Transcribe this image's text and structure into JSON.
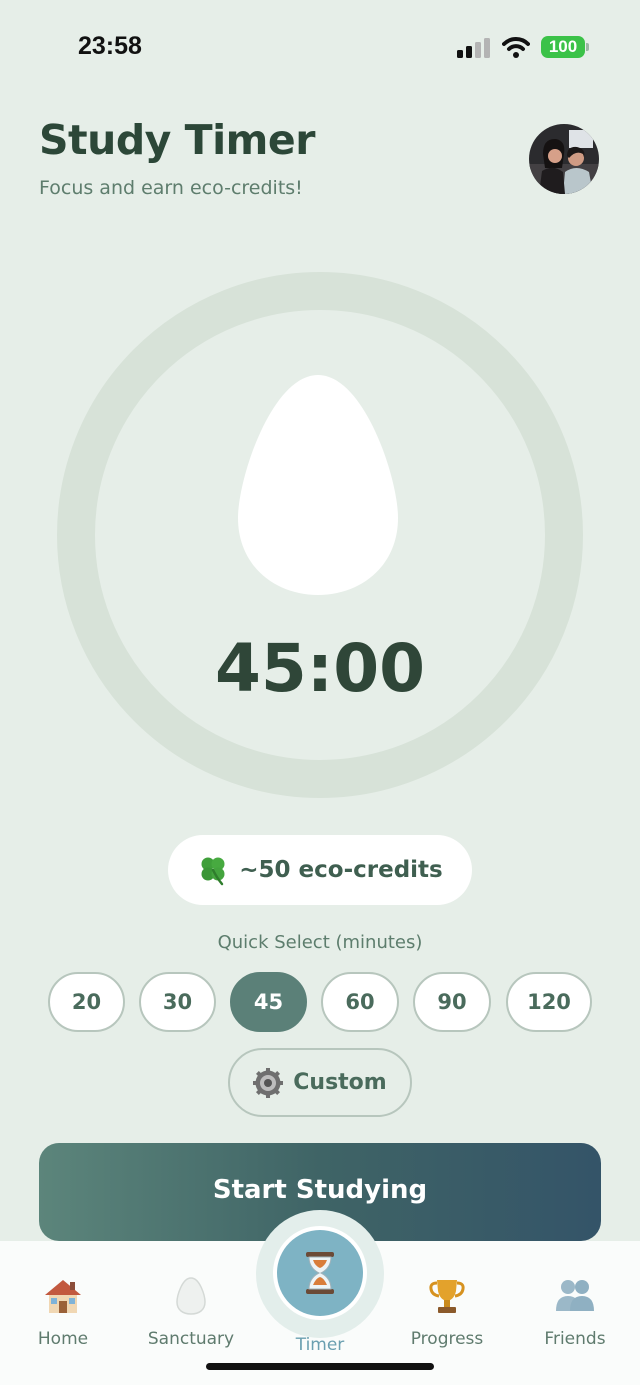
{
  "status_bar": {
    "time": "23:58",
    "battery": "100"
  },
  "header": {
    "title": "Study Timer",
    "subtitle": "Focus and earn eco-credits!"
  },
  "timer": {
    "display": "45:00"
  },
  "credits": {
    "text": "~50 eco-credits"
  },
  "quick_select": {
    "label": "Quick Select (minutes)",
    "options": [
      "20",
      "30",
      "45",
      "60",
      "90",
      "120"
    ],
    "selected": "45"
  },
  "custom_label": "Custom",
  "start_label": "Start Studying",
  "tabs": [
    {
      "label": "Home",
      "icon": "house-icon"
    },
    {
      "label": "Sanctuary",
      "icon": "egg-icon"
    },
    {
      "label": "Timer",
      "icon": "hourglass-icon",
      "active": true
    },
    {
      "label": "Progress",
      "icon": "trophy-icon"
    },
    {
      "label": "Friends",
      "icon": "people-icon"
    }
  ],
  "colors": {
    "background": "#e6eee8",
    "accent": "#5b8078",
    "title": "#2c4738",
    "battery": "#3bc248",
    "start_gradient_start": "#5c857b",
    "start_gradient_end": "#345468",
    "timer_tab": "#7eb3c4"
  }
}
